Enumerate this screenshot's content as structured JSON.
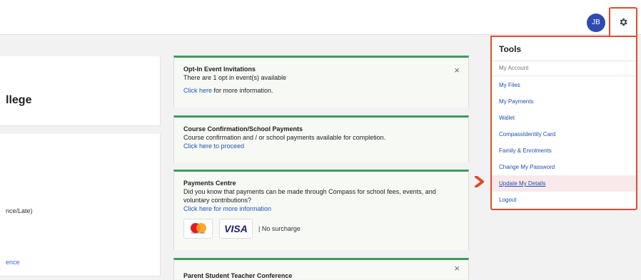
{
  "header": {
    "avatar_initials": "JB",
    "gear_icon": "gear-icon"
  },
  "left": {
    "college_title": "llege",
    "late_text": "nce/Late)",
    "link_text": "ence"
  },
  "notices": {
    "opt_in": {
      "title": "Opt-In Event Invitations",
      "body": "There are 1 opt in event(s) available",
      "link": "Click here",
      "link_suffix": " for more information.",
      "close": "×"
    },
    "course": {
      "title": "Course Confirmation/School Payments",
      "body": "Course confirmation and / or school payments available for completion.",
      "link": "Click here to proceed"
    },
    "payments": {
      "title": "Payments Centre",
      "body": "Did you know that payments can be made through Compass for school fees, events, and voluntary contributions?",
      "link": "Click here for more information",
      "mastercard_caption": "mastercard",
      "visa_label": "VISA",
      "no_surcharge": "| No surcharge"
    },
    "conference": {
      "title": "Parent Student Teacher Conference",
      "close": "×"
    }
  },
  "tools_menu": {
    "title": "Tools",
    "section": "My Account",
    "items": [
      {
        "label": "My Files"
      },
      {
        "label": "My Payments"
      },
      {
        "label": "Wallet"
      },
      {
        "label": "CompassIdentity Card"
      },
      {
        "label": "Family & Enrolments"
      },
      {
        "label": "Change My Password"
      },
      {
        "label": "Update My Details"
      },
      {
        "label": "Logout"
      }
    ],
    "highlighted_item": "Update My Details"
  },
  "colors": {
    "accent_red": "#e04b2f",
    "link_blue": "#1f4fb0",
    "notice_green": "#3e9b5a",
    "avatar_blue": "#2f4bb0"
  }
}
